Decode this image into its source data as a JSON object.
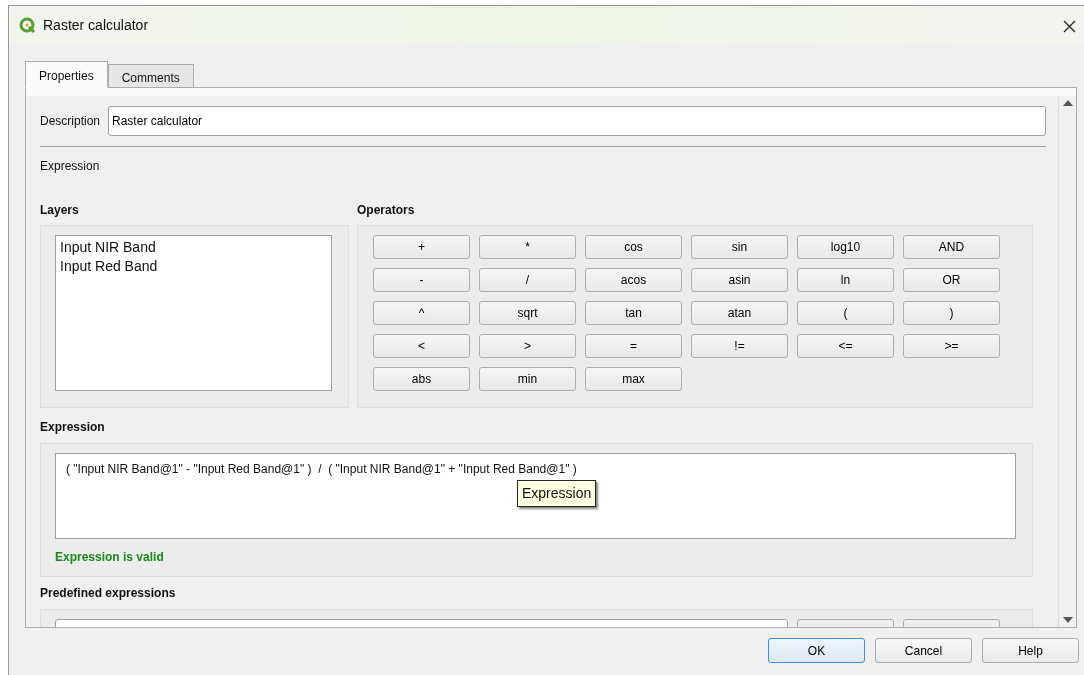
{
  "window": {
    "title": "Raster calculator"
  },
  "tabs": [
    {
      "label": "Properties",
      "selected": true
    },
    {
      "label": "Comments",
      "selected": false
    }
  ],
  "description": {
    "label": "Description",
    "value": "Raster calculator"
  },
  "expression_section": {
    "label": "Expression"
  },
  "layers": {
    "title": "Layers",
    "items": [
      "Input NIR Band",
      "Input Red Band"
    ]
  },
  "operators": {
    "title": "Operators",
    "buttons": [
      "+",
      "*",
      "cos",
      "sin",
      "log10",
      "AND",
      "-",
      "/",
      "acos",
      "asin",
      "ln",
      "OR",
      "^",
      "sqrt",
      "tan",
      "atan",
      "(",
      ")",
      "<",
      ">",
      "=",
      "!=",
      "<=",
      ">=",
      "abs",
      "min",
      "max"
    ]
  },
  "expression": {
    "title": "Expression",
    "value": "( \"Input NIR Band@1\" - \"Input Red Band@1\" )  /  ( \"Input NIR Band@1\" + \"Input Red Band@1\" )",
    "tooltip": "Expression",
    "status": "Expression is valid",
    "valid": true
  },
  "predefined": {
    "title": "Predefined expressions"
  },
  "buttons": [
    {
      "label": "OK",
      "default": true
    },
    {
      "label": "Cancel",
      "default": false
    },
    {
      "label": "Help",
      "default": false
    }
  ]
}
